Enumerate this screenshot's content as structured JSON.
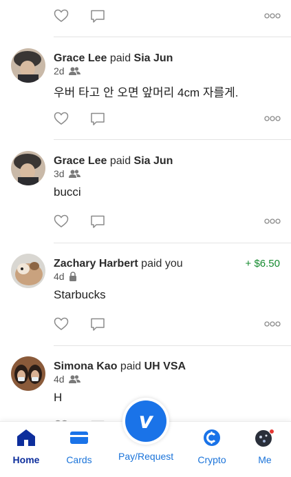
{
  "feed": {
    "items": [
      {
        "payer": "Grace Lee",
        "verb": "paid",
        "payee": "Sia Jun",
        "time": "2d",
        "privacy": "friends",
        "note": "우버 타고 안 오면 앞머리 4cm 자를게.",
        "amount": ""
      },
      {
        "payer": "Grace Lee",
        "verb": "paid",
        "payee": "Sia Jun",
        "time": "3d",
        "privacy": "friends",
        "note": "bucci",
        "amount": ""
      },
      {
        "payer": "Zachary Harbert",
        "verb": "paid",
        "payee": "you",
        "time": "4d",
        "privacy": "private",
        "note": "Starbucks",
        "amount": "+ $6.50"
      },
      {
        "payer": "Simona Kao",
        "verb": "paid",
        "payee": "UH VSA",
        "time": "4d",
        "privacy": "friends",
        "note": "H",
        "amount": ""
      }
    ]
  },
  "tabbar": {
    "home": "Home",
    "cards": "Cards",
    "pay_request": "Pay/Request",
    "crypto": "Crypto",
    "me": "Me",
    "fab_label": "v"
  },
  "colors": {
    "accent": "#1a73e8",
    "active_tab": "#0d2e9c",
    "positive_amount": "#148a2e"
  }
}
